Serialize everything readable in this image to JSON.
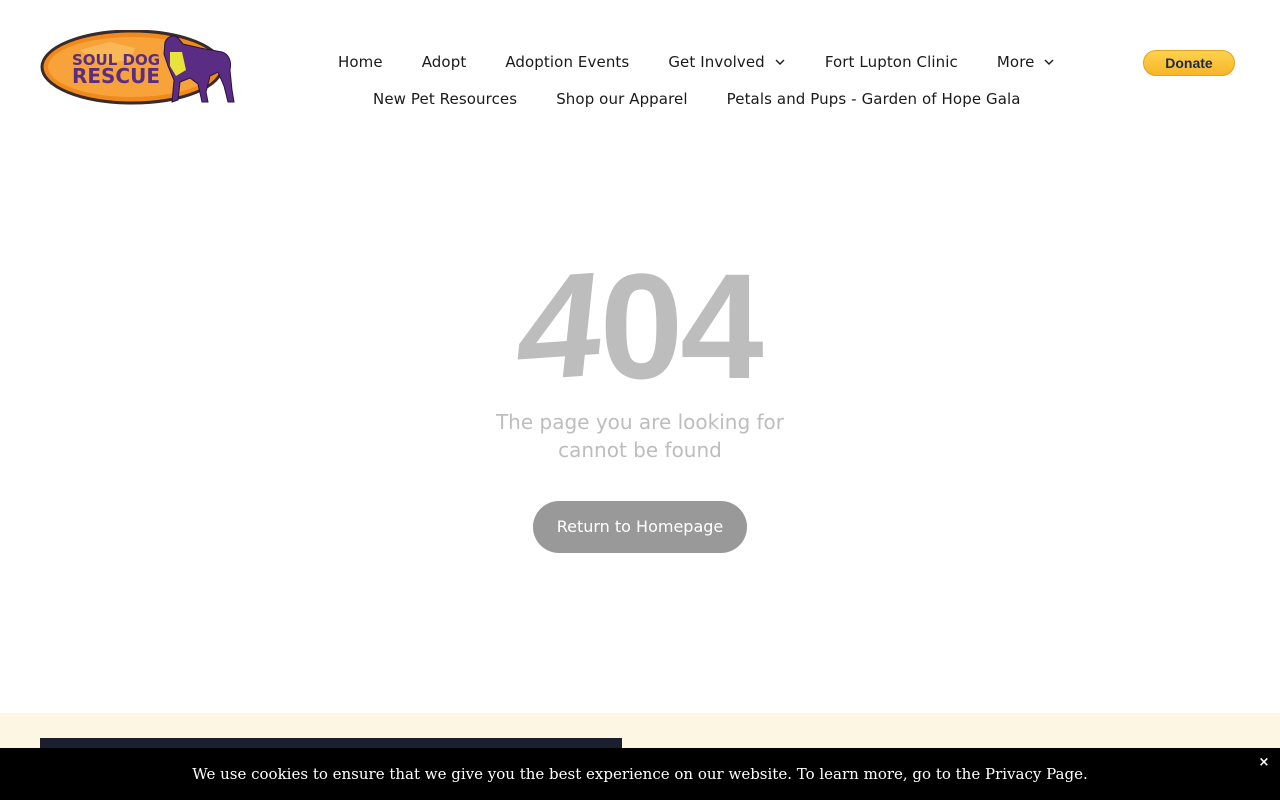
{
  "brand": {
    "logo_line1": "SOUL DOG",
    "logo_line2": "RESCUE",
    "colors": {
      "logo_orange": "#f08a1c",
      "logo_purple": "#5b2c83",
      "logo_yellow": "#e8e23a"
    }
  },
  "nav": {
    "row1": [
      {
        "label": "Home",
        "has_dropdown": false
      },
      {
        "label": "Adopt",
        "has_dropdown": false
      },
      {
        "label": "Adoption Events",
        "has_dropdown": false
      },
      {
        "label": "Get Involved",
        "has_dropdown": true
      },
      {
        "label": "Fort Lupton Clinic",
        "has_dropdown": false
      },
      {
        "label": "More",
        "has_dropdown": true
      }
    ],
    "row2": [
      {
        "label": "New Pet Resources",
        "has_dropdown": false
      },
      {
        "label": "Shop our Apparel",
        "has_dropdown": false
      },
      {
        "label": "Petals and Pups - Garden of Hope Gala",
        "has_dropdown": false
      }
    ],
    "chevron_icon": "chevron-down-icon"
  },
  "donate": {
    "label": "Donate",
    "color": "#ffc439"
  },
  "error": {
    "code_first": "4",
    "code_rest": "04",
    "message_line1": "The page you are looking for",
    "message_line2": "cannot be found",
    "button_label": "Return to Homepage",
    "text_color": "#bdbdbd",
    "button_color": "#999999"
  },
  "cookie": {
    "message": "We use cookies to ensure that we give you the best experience on our website. To learn more, go to the Privacy Page.",
    "close_label": "×"
  }
}
